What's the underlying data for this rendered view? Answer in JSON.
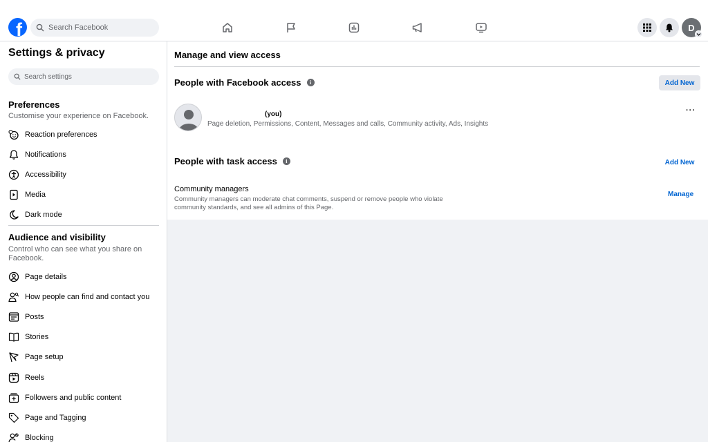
{
  "header": {
    "logo_letter": "f",
    "search_placeholder": "Search Facebook",
    "profile_initial": "D"
  },
  "sidebar": {
    "title": "Settings & privacy",
    "search_placeholder": "Search settings",
    "preferences": {
      "title": "Preferences",
      "description": "Customise your experience on Facebook.",
      "items": [
        {
          "label": "Reaction preferences",
          "icon": "reaction-icon"
        },
        {
          "label": "Notifications",
          "icon": "bell-icon"
        },
        {
          "label": "Accessibility",
          "icon": "accessibility-icon"
        },
        {
          "label": "Media",
          "icon": "media-icon"
        },
        {
          "label": "Dark mode",
          "icon": "moon-icon"
        }
      ]
    },
    "audience": {
      "title": "Audience and visibility",
      "description": "Control who can see what you share on Facebook.",
      "items": [
        {
          "label": "Page details",
          "icon": "user-circle-icon"
        },
        {
          "label": "How people can find and contact you",
          "icon": "user-search-icon"
        },
        {
          "label": "Posts",
          "icon": "posts-icon"
        },
        {
          "label": "Stories",
          "icon": "book-icon"
        },
        {
          "label": "Page setup",
          "icon": "flag-icon"
        },
        {
          "label": "Reels",
          "icon": "reels-icon"
        },
        {
          "label": "Followers and public content",
          "icon": "followers-icon"
        },
        {
          "label": "Page and Tagging",
          "icon": "tag-icon"
        },
        {
          "label": "Blocking",
          "icon": "block-icon"
        }
      ]
    }
  },
  "main": {
    "title": "Manage and view access",
    "facebook_access": {
      "title": "People with Facebook access",
      "add_label": "Add New",
      "person_name": "(you)",
      "permissions": "Page deletion, Permissions, Content, Messages and calls, Community activity, Ads, Insights",
      "more_label": "···"
    },
    "task_access": {
      "title": "People with task access",
      "add_label": "Add New",
      "role_title": "Community managers",
      "role_description": "Community managers can moderate chat comments, suspend or remove people who violate community standards, and see all admins of this Page.",
      "manage_label": "Manage"
    }
  },
  "colors": {
    "brand": "#0866ff",
    "link": "#0064d1",
    "background": "#f0f2f5"
  }
}
